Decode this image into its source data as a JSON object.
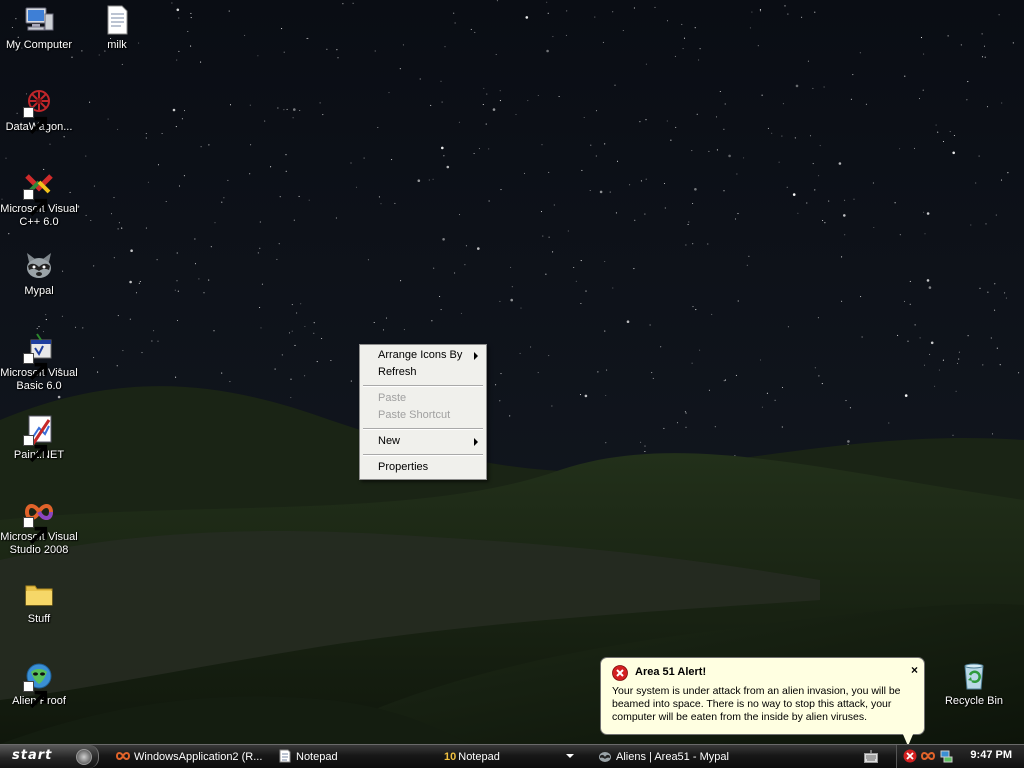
{
  "desktop": {
    "icons": [
      {
        "label": "My Computer",
        "icon": "my-computer-icon"
      },
      {
        "label": "milk",
        "icon": "text-document-icon"
      },
      {
        "label": "DataWagon...",
        "icon": "datawagon-icon"
      },
      {
        "label": "Microsoft Visual\nC++ 6.0",
        "icon": "visual-cpp-icon"
      },
      {
        "label": "Mypal",
        "icon": "mypal-raccoon-icon"
      },
      {
        "label": "Microsoft Visual\nBasic 6.0",
        "icon": "visual-basic-icon"
      },
      {
        "label": "Paint.NET",
        "icon": "paint-net-icon"
      },
      {
        "label": "Microsoft Visual\nStudio 2008",
        "icon": "visual-studio-icon"
      },
      {
        "label": "Stuff",
        "icon": "folder-icon"
      },
      {
        "label": "Alien Proof",
        "icon": "alien-proof-icon"
      },
      {
        "label": "Recycle Bin",
        "icon": "recycle-bin-icon"
      }
    ]
  },
  "context_menu": {
    "arrange_icons_by": "Arrange Icons By",
    "refresh": "Refresh",
    "paste": "Paste",
    "paste_shortcut": "Paste Shortcut",
    "new": "New",
    "properties": "Properties"
  },
  "balloon": {
    "title": "Area 51 Alert!",
    "body": "Your system is under attack from an alien invasion, you will be beamed into space. There is no way to stop this attack, your computer will be eaten from the inside by alien viruses.",
    "close": "×",
    "icon": "error-icon"
  },
  "taskbar": {
    "start_label": "start",
    "tasks": [
      {
        "label": "WindowsApplication2 (R...",
        "icon": "visual-studio-icon"
      },
      {
        "label": "Notepad",
        "icon": "notepad-icon"
      },
      {
        "count": "10",
        "label": "Notepad",
        "icon": "notepad-group-icon"
      },
      {
        "label": "Aliens | Area51 - Mypal",
        "icon": "mypal-raccoon-icon"
      }
    ],
    "clock": "9:47 PM"
  },
  "colors": {
    "sky": "#0b0f17",
    "hills": "#1d2816",
    "balloon_bg": "#ffffe1",
    "menu_bg": "#f0f0ec"
  }
}
